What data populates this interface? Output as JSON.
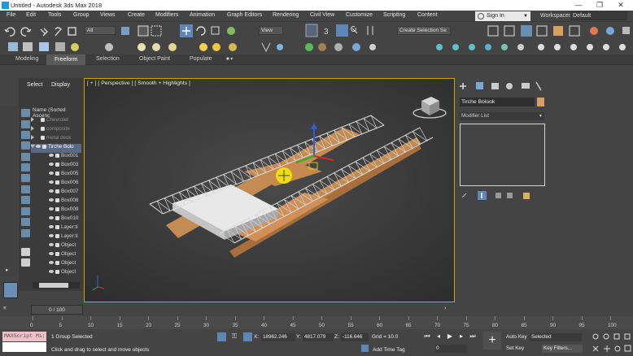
{
  "window": {
    "title": "Untitled - Autodesk 3ds Max 2018",
    "minimize_glyph": "—",
    "restore_glyph": "❐",
    "close_glyph": "✕"
  },
  "menu": [
    "File",
    "Edit",
    "Tools",
    "Group",
    "Views",
    "Create",
    "Modifiers",
    "Animation",
    "Graph Editors",
    "Rendering",
    "Civil View",
    "Customize",
    "Scripting",
    "Content"
  ],
  "account": {
    "signin_label": "Sign In",
    "workspaces_label": "Workspaces:",
    "workspace_value": "Default"
  },
  "toolbar": {
    "filter_value": "All",
    "view_value": "View",
    "selection_set_value": "Create Selection Se"
  },
  "ribbon": {
    "tabs": [
      "Modeling",
      "Freeform",
      "Selection",
      "Object Paint",
      "Populate"
    ],
    "active_tab": "Freeform"
  },
  "explorer": {
    "tabs": [
      "Select",
      "Display"
    ],
    "column_header": "Name (Sorted Ascenc",
    "rows": [
      {
        "label": "Chevrolet",
        "style": "faded"
      },
      {
        "label": "composite",
        "style": "faded"
      },
      {
        "label": "metal deck",
        "style": "faded"
      },
      {
        "label": "Tirche Bolo",
        "style": "selected"
      },
      {
        "label": "Box001",
        "style": "child"
      },
      {
        "label": "Box003",
        "style": "child"
      },
      {
        "label": "Box005",
        "style": "child"
      },
      {
        "label": "Box006",
        "style": "child"
      },
      {
        "label": "Box007",
        "style": "child"
      },
      {
        "label": "Box008",
        "style": "child"
      },
      {
        "label": "Box009",
        "style": "child"
      },
      {
        "label": "Box010",
        "style": "child"
      },
      {
        "label": "Layer:ti",
        "style": "child"
      },
      {
        "label": "Layer:ti",
        "style": "child"
      },
      {
        "label": "Object",
        "style": "child"
      },
      {
        "label": "Object",
        "style": "child"
      },
      {
        "label": "Object",
        "style": "child"
      },
      {
        "label": "Object",
        "style": "child"
      }
    ]
  },
  "viewport": {
    "label": "[ + ] [ Perspective ] [ Smooth + Highlights ]"
  },
  "command_panel": {
    "object_name": "Tirche Bolook",
    "object_color": "#d9a066",
    "modifier_list_label": "Modifier List"
  },
  "timeline": {
    "frame_display": "0 / 100",
    "ticks": [
      "0",
      "5",
      "10",
      "15",
      "20",
      "25",
      "30",
      "35",
      "40",
      "45",
      "50",
      "55",
      "60",
      "65",
      "70",
      "75",
      "80",
      "85",
      "90",
      "95",
      "100"
    ]
  },
  "status": {
    "maxscript_label": "MAXScript Mi:",
    "selection_status": "1 Group Selected",
    "prompt": "Click and drag to select and move objects",
    "x_label": "X:",
    "x_value": "18962.246",
    "y_label": "Y:",
    "y_value": "4817.079",
    "z_label": "Z:",
    "z_value": "-116.646",
    "grid_label": "Grid = 10.0",
    "add_time_tag": "Add Time Tag",
    "auto_key": "Auto Key",
    "auto_key_value": "Selected",
    "set_key": "Set Key",
    "key_filters": "Key Filters...",
    "frame_field": "0"
  },
  "colors": {
    "viewport_border": "#c8a400",
    "deck_wood": "#c48b52",
    "concrete": "#e8e8e8",
    "selection_highlight": "#f2e20a"
  }
}
